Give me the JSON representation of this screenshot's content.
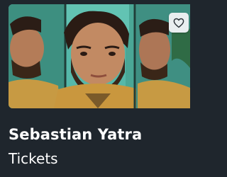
{
  "event_card": {
    "artist_name": "Sebastian Yatra",
    "subtitle": "Tickets",
    "image_icon": "artist-photo",
    "favorite_icon": "heart-outline-icon",
    "colors": {
      "background": "#1f262d",
      "text": "#ffffff",
      "favorite_button_bg": "#e9eef0",
      "photo_backdrop": "#53b5a6"
    }
  }
}
